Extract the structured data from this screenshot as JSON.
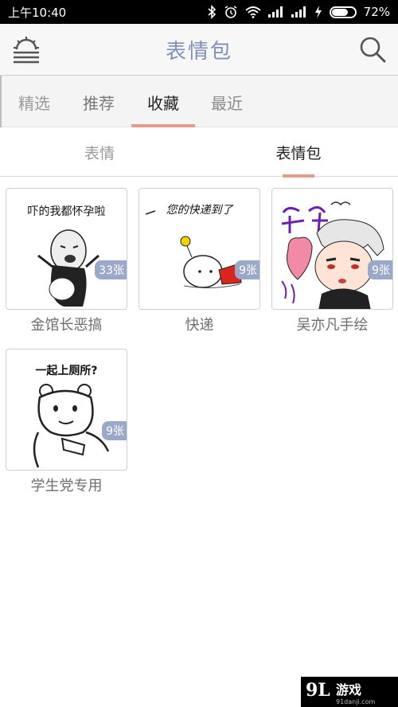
{
  "status_bar": {
    "time": "上午10:40",
    "battery_text": "72%",
    "battery_level": 0.72,
    "icons": [
      "bluetooth-icon",
      "alarm-icon",
      "wifi-icon",
      "signal-icon",
      "signal-icon",
      "charging-icon",
      "battery-icon"
    ]
  },
  "header": {
    "title": "表情包",
    "left_icon": "sunrise-menu-icon",
    "right_icon": "search-icon",
    "title_color": "#7f8fb8"
  },
  "main_tabs": [
    {
      "label": "精选"
    },
    {
      "label": "推荐"
    },
    {
      "label": "收藏",
      "active": true
    },
    {
      "label": "最近"
    }
  ],
  "sub_tabs": [
    {
      "label": "表情"
    },
    {
      "label": "表情包",
      "active": true
    }
  ],
  "accent_color": "#e59b8c",
  "badge_color": "#9aa8c9",
  "packs": [
    {
      "name": "金馆长恶搞",
      "count": "33张",
      "caption": "吓的我都怀孕啦"
    },
    {
      "name": "快递",
      "count": "9张",
      "caption": "您的快递到了"
    },
    {
      "name": "吴亦凡手绘",
      "count": "9张",
      "caption": ""
    },
    {
      "name": "学生党专用",
      "count": "9张",
      "caption": "一起上厕所?"
    }
  ],
  "watermark": {
    "logo": "9L",
    "text": "游戏",
    "sub": "91danji.com"
  }
}
